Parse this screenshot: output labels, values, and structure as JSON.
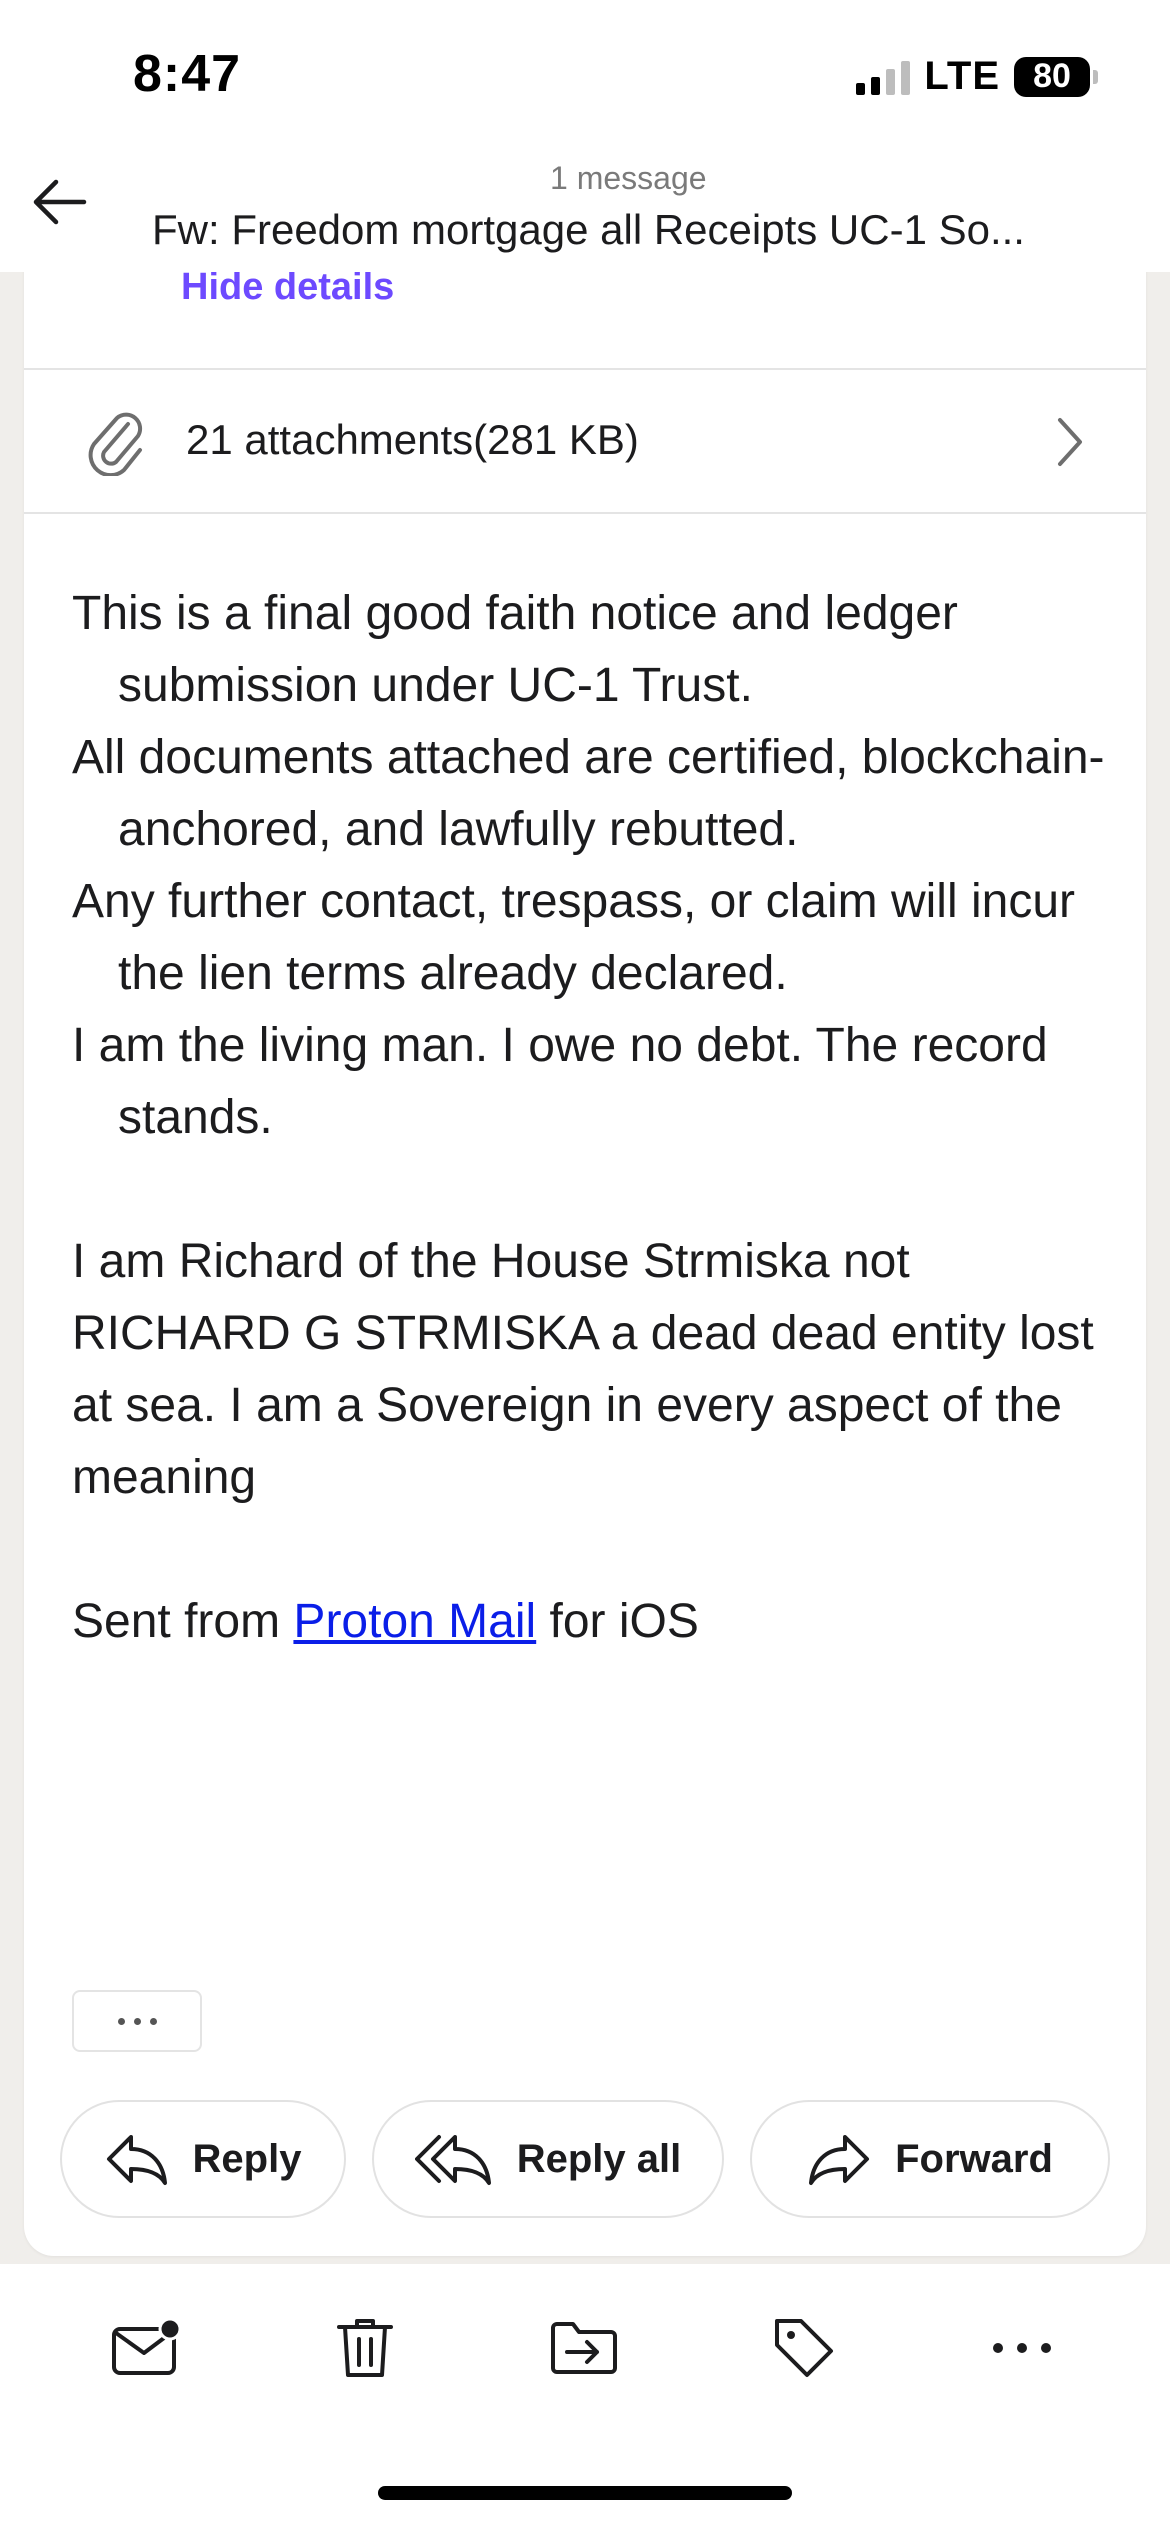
{
  "status_bar": {
    "time": "8:47",
    "network": "LTE",
    "battery": "80"
  },
  "header": {
    "message_count": "1 message",
    "subject": "Fw: Freedom mortgage all Receipts UC-1 So..."
  },
  "message": {
    "hide_details_label": "Hide details",
    "attachments_label": "21 attachments(281 KB)",
    "body_paragraphs": [
      "This is a final good faith notice and ledger submission under UC-1 Trust.",
      "All documents attached are certified, blockchain-anchored, and lawfully rebutted.",
      "Any further contact, trespass, or claim will incur the lien terms already declared.",
      "I am the living man. I owe no debt. The record stands."
    ],
    "sovereign_paragraph": "I am Richard of the House Strmiska not RICHARD G STRMISKA a dead dead entity lost at sea. I am a Sovereign in every aspect of the meaning",
    "signature": {
      "prefix": "Sent from ",
      "link_text": "Proton Mail",
      "suffix": " for iOS"
    }
  },
  "actions": {
    "reply_label": "Reply",
    "reply_all_label": "Reply all",
    "forward_label": "Forward"
  },
  "toolbar": {
    "icons": [
      "mark-unread-icon",
      "trash-icon",
      "move-to-folder-icon",
      "label-icon",
      "more-icon"
    ]
  },
  "colors": {
    "accent": "#6d4aff",
    "link": "#0a1ee8",
    "background": "#f0eeeb"
  }
}
